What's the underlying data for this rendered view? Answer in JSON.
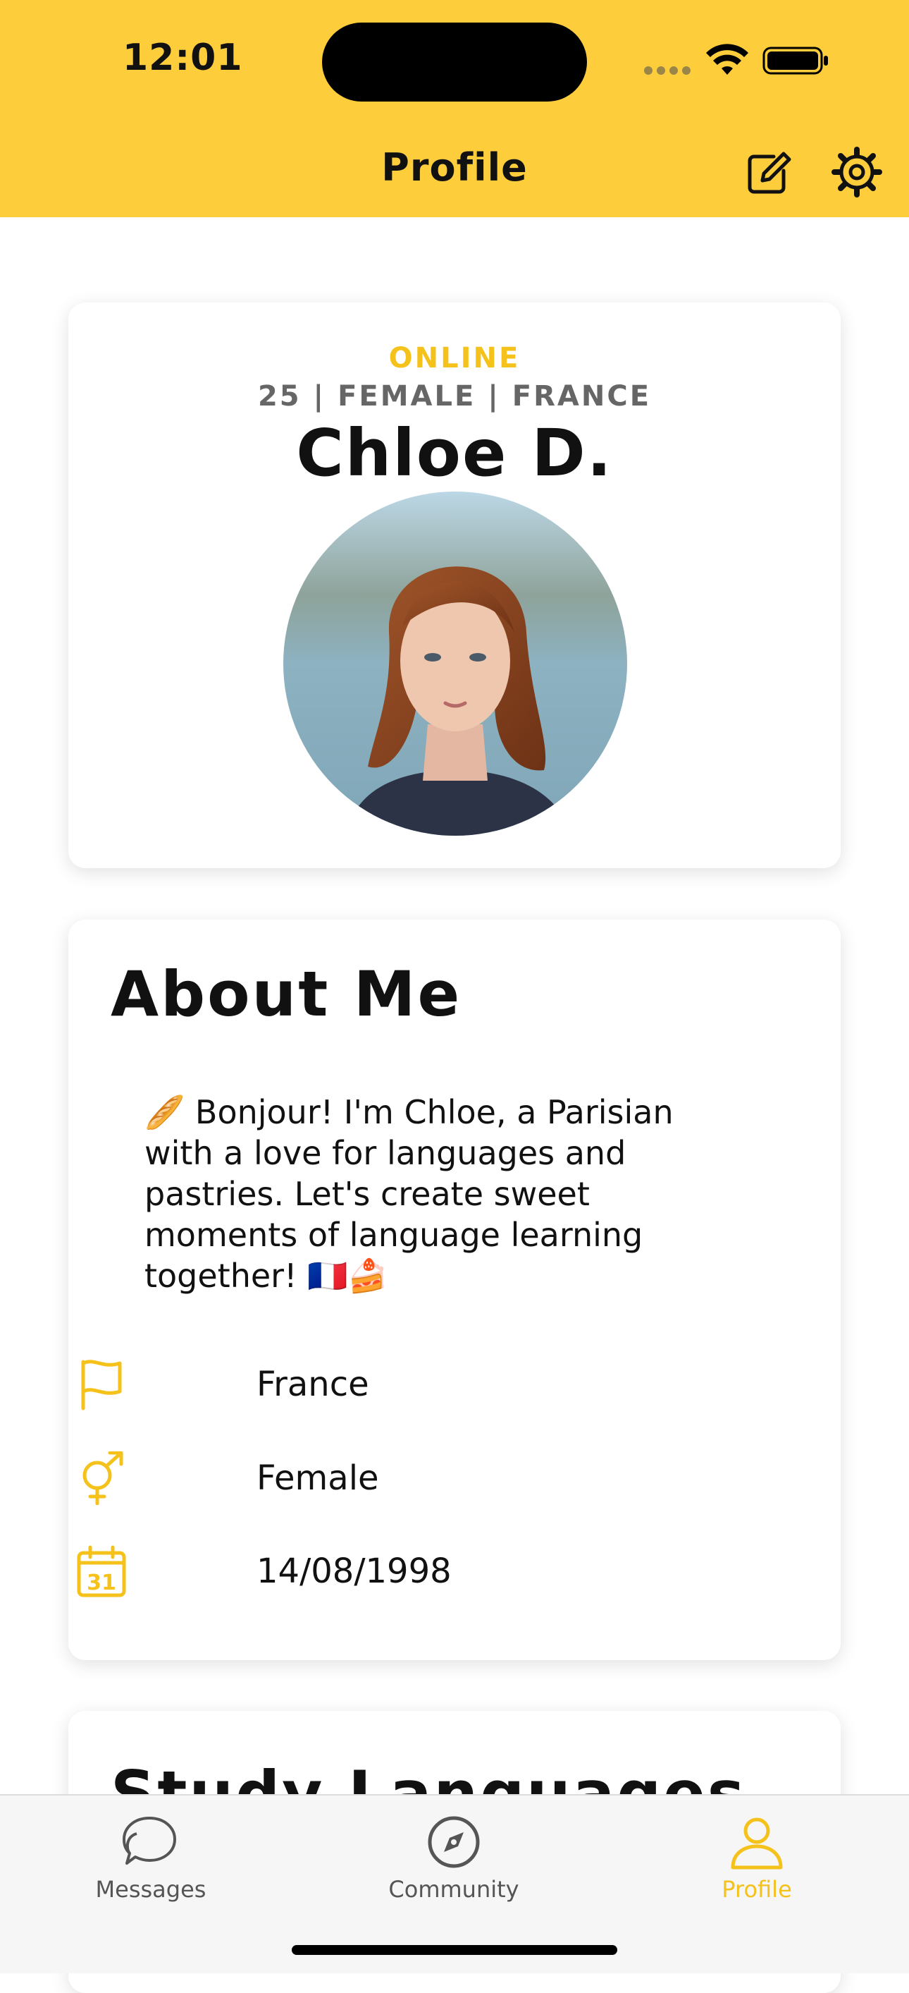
{
  "status_bar": {
    "time": "12:01"
  },
  "header": {
    "title": "Profile",
    "background": "#FDCD3B",
    "actions": [
      "edit-icon",
      "gear-icon"
    ]
  },
  "profile": {
    "status": "ONLINE",
    "meta": "25 | FEMALE | FRANCE",
    "name": "Chloe D."
  },
  "about": {
    "title": "About Me",
    "bio": "🥖 Bonjour! I'm Chloe, a Parisian with a love for languages and pastries. Let's create sweet moments of language learning together! 🇫🇷🍰",
    "rows": [
      {
        "icon": "flag-icon",
        "value": "France"
      },
      {
        "icon": "gender-icon",
        "value": "Female"
      },
      {
        "icon": "calendar-icon",
        "value": "14/08/1998"
      }
    ]
  },
  "study": {
    "title": "Study Languages"
  },
  "tabbar": {
    "tabs": [
      {
        "icon": "chat-icon",
        "label": "Messages",
        "active": false
      },
      {
        "icon": "compass-icon",
        "label": "Community",
        "active": false
      },
      {
        "icon": "person-icon",
        "label": "Profile",
        "active": true
      }
    ]
  },
  "colors": {
    "accent": "#F5C21B",
    "header": "#FDCD3B"
  }
}
